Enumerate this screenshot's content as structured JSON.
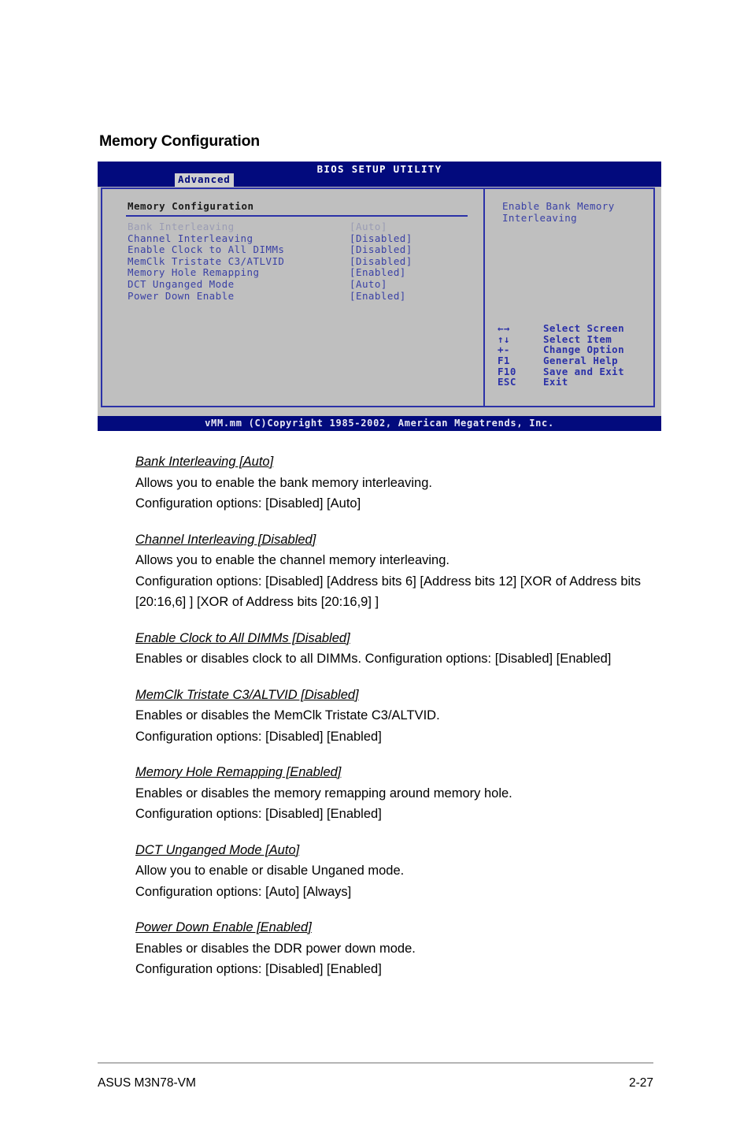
{
  "page": {
    "heading": "Memory Configuration",
    "footer_left": "ASUS M3N78-VM",
    "footer_right": "2-27"
  },
  "bios": {
    "title": "BIOS SETUP UTILITY",
    "active_tab": "Advanced",
    "section_title": "Memory Configuration",
    "copyright": "vMM.mm (C)Copyright 1985-2002, American Megatrends, Inc.",
    "colors": {
      "titlebar": "#020a7d",
      "panel_bg": "#bfbfbf",
      "border": "#2b31a8",
      "text": "#3a41a5",
      "selected_text": "#9a9cb4"
    },
    "options": [
      {
        "label": "Bank Interleaving",
        "value": "[Auto]",
        "selected": true
      },
      {
        "label": "Channel Interleaving",
        "value": "[Disabled]",
        "selected": false
      },
      {
        "label": "Enable Clock to All DIMMs",
        "value": "[Disabled]",
        "selected": false
      },
      {
        "label": "MemClk Tristate C3/ATLVID",
        "value": "[Disabled]",
        "selected": false
      },
      {
        "label": "Memory Hole Remapping",
        "value": "[Enabled]",
        "selected": false
      },
      {
        "label": "DCT Unganged Mode",
        "value": "[Auto]",
        "selected": false
      },
      {
        "label": "Power Down Enable",
        "value": "[Enabled]",
        "selected": false
      }
    ],
    "help": {
      "line1": "Enable Bank Memory",
      "line2": "Interleaving"
    },
    "keys": [
      {
        "key": "←→",
        "desc": "Select Screen"
      },
      {
        "key": "↑↓",
        "desc": "Select Item"
      },
      {
        "key": "+-",
        "desc": "Change Option"
      },
      {
        "key": "F1",
        "desc": "General Help"
      },
      {
        "key": "F10",
        "desc": "Save and Exit"
      },
      {
        "key": "ESC",
        "desc": "Exit"
      }
    ]
  },
  "descriptions": [
    {
      "head": "Bank Interleaving [Auto]",
      "lines": [
        "Allows you to enable the bank memory interleaving.",
        "Configuration options: [Disabled] [Auto]"
      ]
    },
    {
      "head": "Channel Interleaving [Disabled]",
      "lines": [
        "Allows you to enable the channel memory interleaving.",
        "Configuration options: [Disabled] [Address bits 6] [Address bits 12] [XOR of Address bits [20:16,6] ] [XOR of Address bits [20:16,9] ]"
      ]
    },
    {
      "head": "Enable Clock to All DIMMs [Disabled]",
      "lines": [
        "Enables or disables clock to all DIMMs. Configuration options: [Disabled] [Enabled]"
      ]
    },
    {
      "head": "MemClk Tristate C3/ALTVID [Disabled]",
      "lines": [
        "Enables or disables the MemClk Tristate C3/ALTVID.",
        "Configuration options: [Disabled] [Enabled]"
      ]
    },
    {
      "head": "Memory Hole Remapping [Enabled]",
      "lines": [
        "Enables or disables the memory remapping around memory hole.",
        "Configuration options: [Disabled] [Enabled]"
      ]
    },
    {
      "head": "DCT Unganged Mode [Auto]",
      "lines": [
        "Allow you to enable or disable Unganed mode.",
        "Configuration options: [Auto] [Always]"
      ]
    },
    {
      "head": "Power Down Enable [Enabled]",
      "lines": [
        "Enables or disables the DDR power down mode.",
        "Configuration options: [Disabled] [Enabled]"
      ]
    }
  ]
}
